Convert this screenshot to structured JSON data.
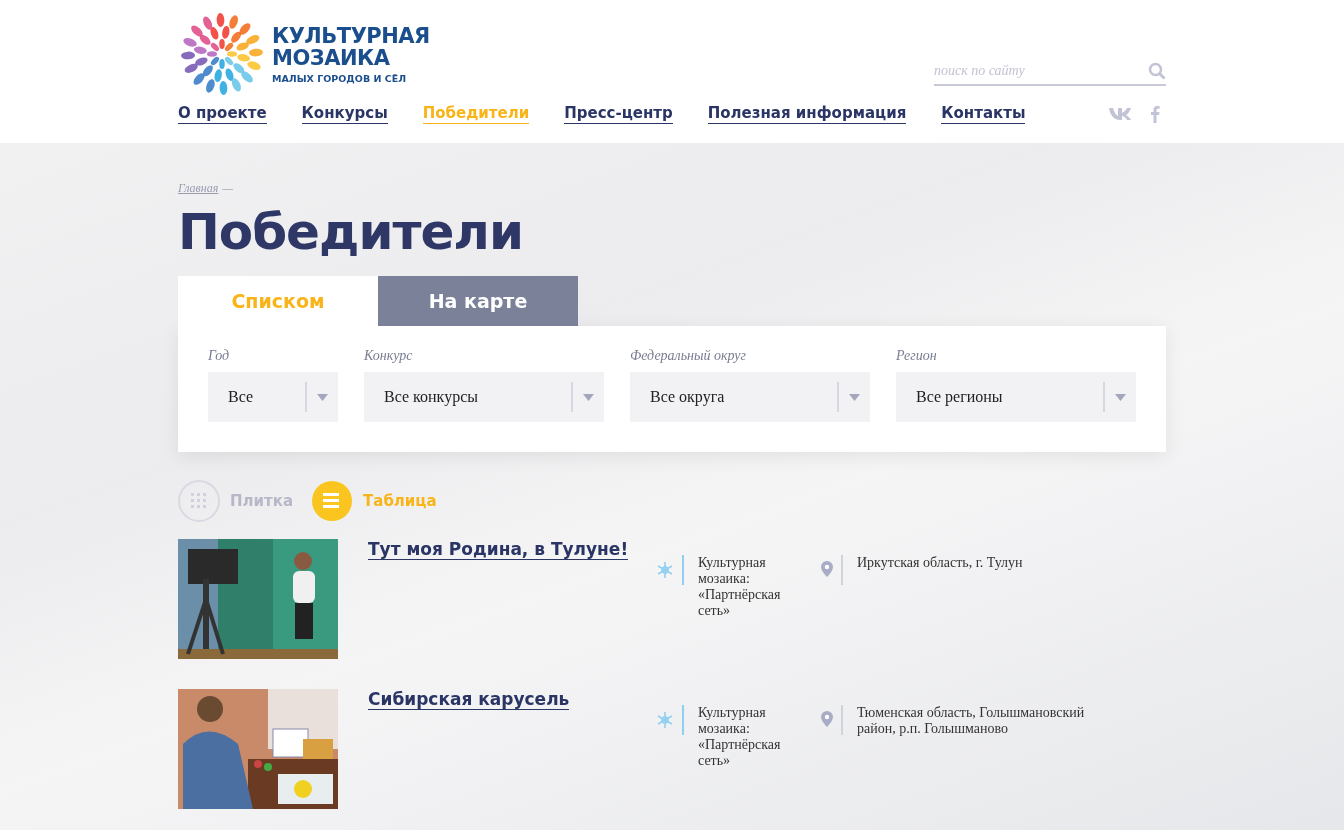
{
  "logo": {
    "line1": "КУЛЬТУРНАЯ",
    "line2": "МОЗАИКА",
    "line3": "МАЛЫХ ГОРОДОВ И СЁЛ"
  },
  "search": {
    "placeholder": "поиск по сайту"
  },
  "nav": [
    {
      "label": "О проекте",
      "selected": false
    },
    {
      "label": "Конкурсы",
      "selected": false
    },
    {
      "label": "Победители",
      "selected": true
    },
    {
      "label": "Пресс-центр",
      "selected": false
    },
    {
      "label": "Полезная информация",
      "selected": false
    },
    {
      "label": "Контакты",
      "selected": false
    }
  ],
  "breadcrumb": {
    "link": "Главная",
    "separator": "—"
  },
  "title": "Победители",
  "tabs": [
    {
      "label": "Списком",
      "selected": true
    },
    {
      "label": "На карте",
      "selected": false
    }
  ],
  "filters": [
    {
      "label": "Год",
      "value": "Все"
    },
    {
      "label": "Конкурс",
      "value": "Все конкурсы"
    },
    {
      "label": "Федеральный округ",
      "value": "Все округа"
    },
    {
      "label": "Регион",
      "value": "Все регионы"
    }
  ],
  "view_modes": [
    {
      "kind": "tiles",
      "label": "Плитка",
      "selected": false
    },
    {
      "kind": "table",
      "label": "Таблица",
      "selected": true
    }
  ],
  "winners": [
    {
      "title": "Тут моя Родина, в Тулуне!",
      "contest": "Культурная мозаика: «Партнёрская сеть»",
      "region": "Иркутская область, г. Тулун"
    },
    {
      "title": "Сибирская карусель",
      "contest": "Культурная мозаика: «Партнёрская сеть»",
      "region": "Тюменская область, Голышмановский район, р.п. Голышманово"
    }
  ]
}
